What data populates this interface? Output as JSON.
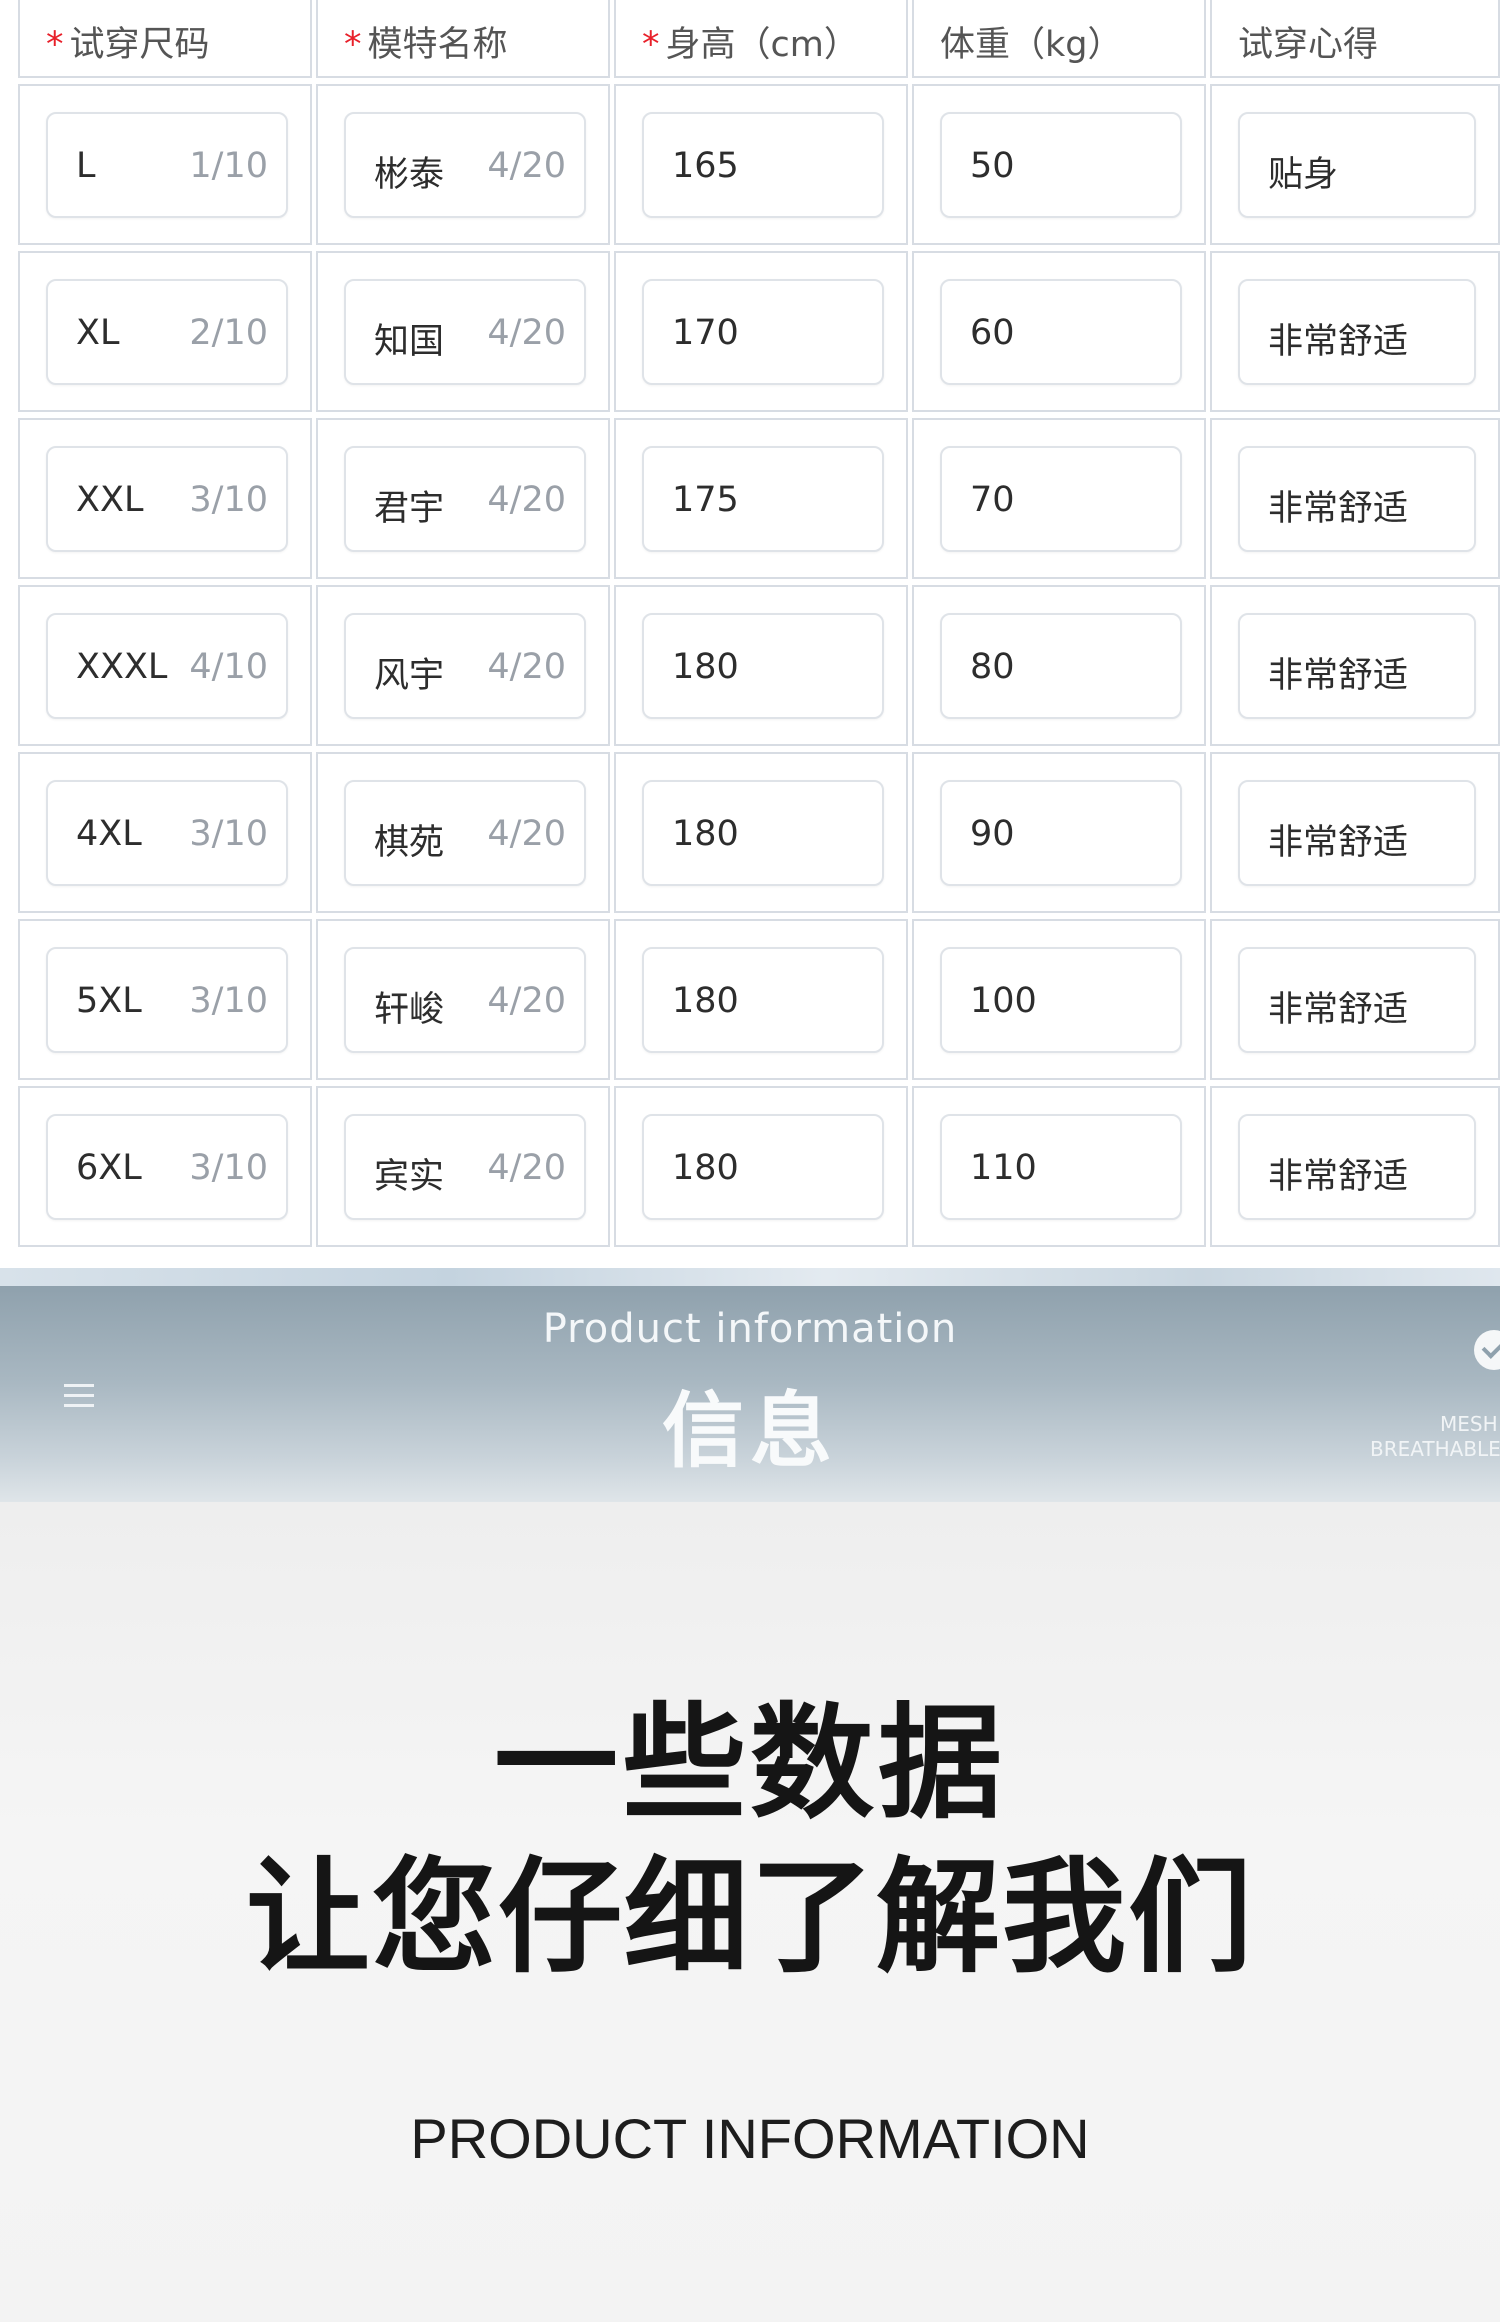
{
  "table": {
    "columns": [
      {
        "label": "试穿尺码",
        "required": true
      },
      {
        "label": "模特名称",
        "required": true
      },
      {
        "label": "身高（cm）",
        "required": true
      },
      {
        "label": "体重（kg）",
        "required": false
      },
      {
        "label": "试穿心得",
        "required": false
      }
    ],
    "required_mark": "*",
    "rows": [
      {
        "size": "L",
        "size_count": "1/10",
        "model": "彬泰",
        "model_count": "4/20",
        "height": "165",
        "weight": "50",
        "feedback": "贴身"
      },
      {
        "size": "XL",
        "size_count": "2/10",
        "model": "知国",
        "model_count": "4/20",
        "height": "170",
        "weight": "60",
        "feedback": "非常舒适"
      },
      {
        "size": "XXL",
        "size_count": "3/10",
        "model": "君宇",
        "model_count": "4/20",
        "height": "175",
        "weight": "70",
        "feedback": "非常舒适"
      },
      {
        "size": "XXXL",
        "size_count": "4/10",
        "model": "风宇",
        "model_count": "4/20",
        "height": "180",
        "weight": "80",
        "feedback": "非常舒适"
      },
      {
        "size": "4XL",
        "size_count": "3/10",
        "model": "棋苑",
        "model_count": "4/20",
        "height": "180",
        "weight": "90",
        "feedback": "非常舒适"
      },
      {
        "size": "5XL",
        "size_count": "3/10",
        "model": "轩峻",
        "model_count": "4/20",
        "height": "180",
        "weight": "100",
        "feedback": "非常舒适"
      },
      {
        "size": "6XL",
        "size_count": "3/10",
        "model": "宾实",
        "model_count": "4/20",
        "height": "180",
        "weight": "110",
        "feedback": "非常舒适"
      }
    ]
  },
  "banner": {
    "subtitle": "Product information",
    "title": "信息",
    "menu_icon": "menu-icon",
    "check_icon": "check-circle-icon",
    "tag_line1": "MESH",
    "tag_line2": "BREATHABLE"
  },
  "info": {
    "line1": "一些数据",
    "line2": "让您仔细了解我们",
    "english": "PRODUCT INFORMATION"
  },
  "colors": {
    "required_star": "#e8202a",
    "border": "#d7dce3",
    "banner_top": "#8fa1ad",
    "headline": "#151515"
  }
}
